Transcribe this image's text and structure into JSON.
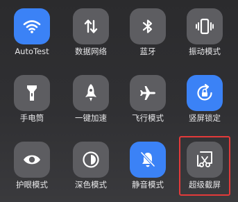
{
  "tiles": [
    {
      "label": "AutoTest",
      "icon": "wifi-icon",
      "active": true
    },
    {
      "label": "数据网络",
      "icon": "mobile-data-icon",
      "active": false
    },
    {
      "label": "蓝牙",
      "icon": "bluetooth-icon",
      "active": false
    },
    {
      "label": "振动模式",
      "icon": "vibrate-icon",
      "active": false
    },
    {
      "label": "手电筒",
      "icon": "flashlight-icon",
      "active": false
    },
    {
      "label": "一键加速",
      "icon": "rocket-icon",
      "active": false
    },
    {
      "label": "飞行模式",
      "icon": "airplane-icon",
      "active": false
    },
    {
      "label": "竖屏锁定",
      "icon": "rotation-lock-icon",
      "active": true
    },
    {
      "label": "护眼模式",
      "icon": "eye-icon",
      "active": false
    },
    {
      "label": "深色模式",
      "icon": "dark-mode-icon",
      "active": false
    },
    {
      "label": "静音模式",
      "icon": "mute-bell-icon",
      "active": true
    },
    {
      "label": "超级截屏",
      "icon": "super-screenshot-icon",
      "active": false
    }
  ],
  "colors": {
    "active": "#3b82f6",
    "inactive": "#5d5d61",
    "highlight": "#e43a3a"
  }
}
